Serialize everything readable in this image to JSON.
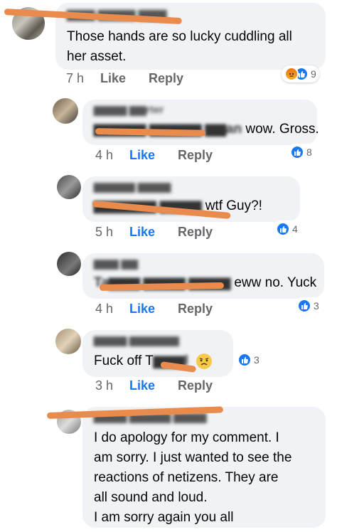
{
  "comments": [
    {
      "author": "▆▆▆ ▆▆▆▆ ▆▆▆",
      "text": "Those hands are so lucky cuddling all her asset.",
      "time": "7 h",
      "like_label": "Like",
      "reply_label": "Reply",
      "reaction_count": "9",
      "reactions": [
        "angry-icon",
        "like-icon"
      ],
      "liked": false
    },
    {
      "author": "▆▆▆▆ ▆▆rter",
      "mention": "▆▆▆▆▆ ▆▆▆▆▆ ▆▆an",
      "text": "wow. Gross.",
      "time": "4 h",
      "like_label": "Like",
      "reply_label": "Reply",
      "reaction_count": "8",
      "reactions": [
        "like-icon"
      ],
      "liked": true
    },
    {
      "author": "▆▆▆▆▆ ▆▆▆▆",
      "mention": "▆▆▆▆▆▆ ▆▆▆▆",
      "text": "wtf Guy?!",
      "time": "5 h",
      "like_label": "Like",
      "reply_label": "Reply",
      "reaction_count": "4",
      "reactions": [
        "like-icon"
      ],
      "liked": true
    },
    {
      "author": "▆▆▆ ▆▆",
      "mention": "Ta▆▆▆ ▆▆▆▆ ▆▆▆▆",
      "text": "eww no. Yuck",
      "time": "4 h",
      "like_label": "Like",
      "reply_label": "Reply",
      "reaction_count": "3",
      "reactions": [
        "like-icon"
      ],
      "liked": true
    },
    {
      "author": "▆▆▆▆ ▆▆▆▆▆▆",
      "text_prefix": "Fuck off T",
      "mention": "▆▆▆l",
      "emoji": "disappointed-emoji",
      "time": "3 h",
      "like_label": "Like",
      "reply_label": "Reply",
      "reaction_count": "3",
      "reactions": [
        "like-icon"
      ],
      "liked": true
    },
    {
      "author": "▆▆▆▆ ▆▆▆▆▆ ▆▆▆▆",
      "text_lines": [
        "I do apology for my comment. I",
        "am sorry. I just wanted to see the",
        "reactions of netizens. They are",
        "all sound and loud.",
        "I am sorry again you all"
      ]
    }
  ],
  "colors": {
    "bubble": "#f0f2f5",
    "like_blue": "#1877f2",
    "meta_gray": "#65676b",
    "scribble_orange": "#e98b4c"
  }
}
